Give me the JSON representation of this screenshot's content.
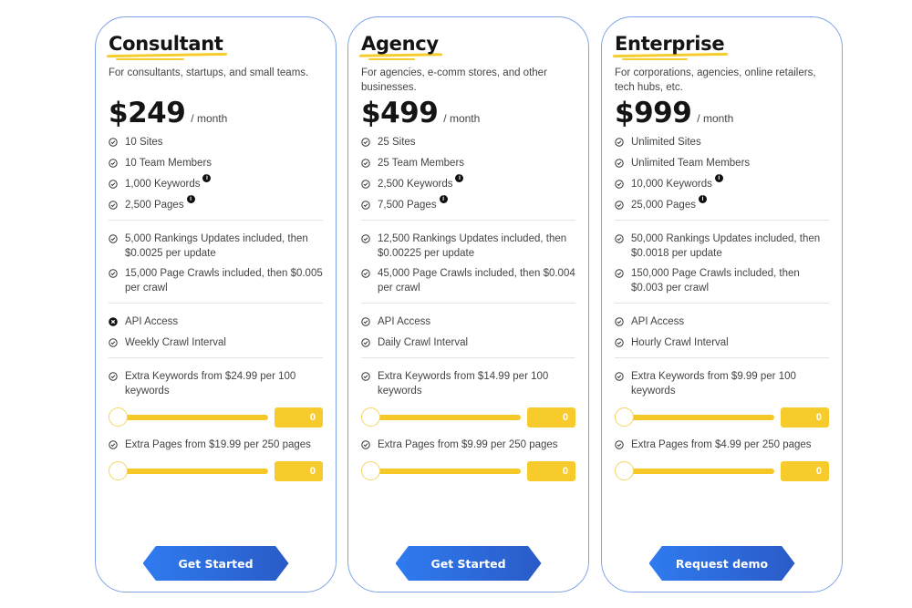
{
  "plans": [
    {
      "name": "Consultant",
      "description": "For consultants, startups, and small teams.",
      "price": "$249",
      "period": "/ month",
      "basic": [
        {
          "text": "10 Sites",
          "icon": "check-circle-icon",
          "info": false
        },
        {
          "text": "10 Team Members",
          "icon": "check-circle-icon",
          "info": false
        },
        {
          "text": "1,000 Keywords",
          "icon": "check-circle-icon",
          "info": true
        },
        {
          "text": "2,500 Pages",
          "icon": "check-circle-icon",
          "info": true
        }
      ],
      "usage": [
        {
          "text": "5,000 Rankings Updates included, then $0.0025 per update",
          "icon": "check-circle-icon"
        },
        {
          "text": "15,000 Page Crawls included, then $0.005 per crawl",
          "icon": "check-circle-icon"
        }
      ],
      "access": [
        {
          "text": "API Access",
          "icon": "x-circle-icon"
        },
        {
          "text": "Weekly Crawl Interval",
          "icon": "check-circle-icon"
        }
      ],
      "extras": [
        {
          "text": "Extra Keywords from $24.99 per 100 keywords",
          "value": "0",
          "slider_fraction": 0
        },
        {
          "text": "Extra Pages from $19.99 per 250 pages",
          "value": "0",
          "slider_fraction": 0
        }
      ],
      "cta": "Get Started"
    },
    {
      "name": "Agency",
      "description": "For agencies, e-comm stores, and other businesses.",
      "price": "$499",
      "period": "/ month",
      "basic": [
        {
          "text": "25 Sites",
          "icon": "check-circle-icon",
          "info": false
        },
        {
          "text": "25 Team Members",
          "icon": "check-circle-icon",
          "info": false
        },
        {
          "text": "2,500 Keywords",
          "icon": "check-circle-icon",
          "info": true
        },
        {
          "text": "7,500 Pages",
          "icon": "check-circle-icon",
          "info": true
        }
      ],
      "usage": [
        {
          "text": "12,500 Rankings Updates included, then $0.00225 per update",
          "icon": "check-circle-icon"
        },
        {
          "text": "45,000 Page Crawls included, then $0.004 per crawl",
          "icon": "check-circle-icon"
        }
      ],
      "access": [
        {
          "text": "API Access",
          "icon": "check-circle-icon"
        },
        {
          "text": "Daily Crawl Interval",
          "icon": "check-circle-icon"
        }
      ],
      "extras": [
        {
          "text": "Extra Keywords from $14.99 per 100 keywords",
          "value": "0",
          "slider_fraction": 0
        },
        {
          "text": "Extra Pages from $9.99 per 250 pages",
          "value": "0",
          "slider_fraction": 0
        }
      ],
      "cta": "Get Started"
    },
    {
      "name": "Enterprise",
      "description": "For corporations, agencies, online retailers, tech hubs, etc.",
      "price": "$999",
      "period": "/ month",
      "basic": [
        {
          "text": "Unlimited Sites",
          "icon": "check-circle-icon",
          "info": false
        },
        {
          "text": "Unlimited Team Members",
          "icon": "check-circle-icon",
          "info": false
        },
        {
          "text": "10,000 Keywords",
          "icon": "check-circle-icon",
          "info": true
        },
        {
          "text": "25,000 Pages",
          "icon": "check-circle-icon",
          "info": true
        }
      ],
      "usage": [
        {
          "text": "50,000 Rankings Updates included, then $0.0018 per update",
          "icon": "check-circle-icon"
        },
        {
          "text": "150,000 Page Crawls included, then $0.003 per crawl",
          "icon": "check-circle-icon"
        }
      ],
      "access": [
        {
          "text": "API Access",
          "icon": "check-circle-icon"
        },
        {
          "text": "Hourly Crawl Interval",
          "icon": "check-circle-icon"
        }
      ],
      "extras": [
        {
          "text": "Extra Keywords from $9.99 per 100 keywords",
          "value": "0",
          "slider_fraction": 0
        },
        {
          "text": "Extra Pages from $4.99 per 250 pages",
          "value": "0",
          "slider_fraction": 0
        }
      ],
      "cta": "Request demo"
    }
  ],
  "info_glyph": "i",
  "colors": {
    "accent_yellow": "#f8cb2d",
    "card_border": "#7ea3e6",
    "button_start": "#2f7bf0",
    "button_end": "#2a5bc7"
  }
}
